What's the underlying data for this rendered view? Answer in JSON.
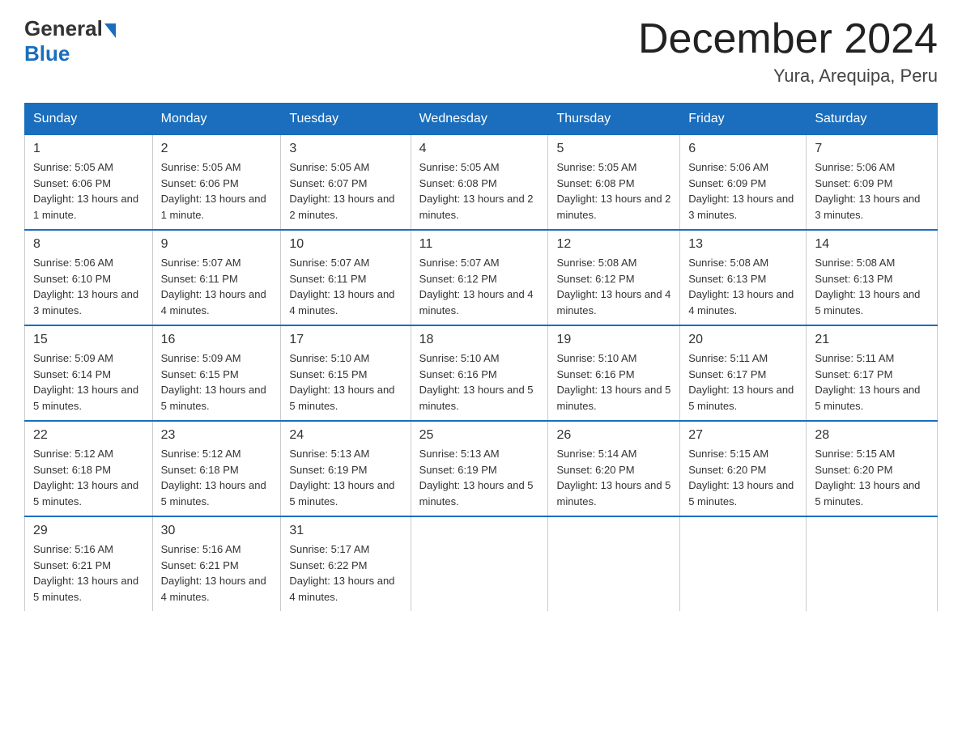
{
  "header": {
    "logo": {
      "general": "General",
      "blue": "Blue"
    },
    "title": "December 2024",
    "location": "Yura, Arequipa, Peru"
  },
  "days_header": [
    "Sunday",
    "Monday",
    "Tuesday",
    "Wednesday",
    "Thursday",
    "Friday",
    "Saturday"
  ],
  "weeks": [
    [
      {
        "day": "1",
        "sunrise": "5:05 AM",
        "sunset": "6:06 PM",
        "daylight": "13 hours and 1 minute."
      },
      {
        "day": "2",
        "sunrise": "5:05 AM",
        "sunset": "6:06 PM",
        "daylight": "13 hours and 1 minute."
      },
      {
        "day": "3",
        "sunrise": "5:05 AM",
        "sunset": "6:07 PM",
        "daylight": "13 hours and 2 minutes."
      },
      {
        "day": "4",
        "sunrise": "5:05 AM",
        "sunset": "6:08 PM",
        "daylight": "13 hours and 2 minutes."
      },
      {
        "day": "5",
        "sunrise": "5:05 AM",
        "sunset": "6:08 PM",
        "daylight": "13 hours and 2 minutes."
      },
      {
        "day": "6",
        "sunrise": "5:06 AM",
        "sunset": "6:09 PM",
        "daylight": "13 hours and 3 minutes."
      },
      {
        "day": "7",
        "sunrise": "5:06 AM",
        "sunset": "6:09 PM",
        "daylight": "13 hours and 3 minutes."
      }
    ],
    [
      {
        "day": "8",
        "sunrise": "5:06 AM",
        "sunset": "6:10 PM",
        "daylight": "13 hours and 3 minutes."
      },
      {
        "day": "9",
        "sunrise": "5:07 AM",
        "sunset": "6:11 PM",
        "daylight": "13 hours and 4 minutes."
      },
      {
        "day": "10",
        "sunrise": "5:07 AM",
        "sunset": "6:11 PM",
        "daylight": "13 hours and 4 minutes."
      },
      {
        "day": "11",
        "sunrise": "5:07 AM",
        "sunset": "6:12 PM",
        "daylight": "13 hours and 4 minutes."
      },
      {
        "day": "12",
        "sunrise": "5:08 AM",
        "sunset": "6:12 PM",
        "daylight": "13 hours and 4 minutes."
      },
      {
        "day": "13",
        "sunrise": "5:08 AM",
        "sunset": "6:13 PM",
        "daylight": "13 hours and 4 minutes."
      },
      {
        "day": "14",
        "sunrise": "5:08 AM",
        "sunset": "6:13 PM",
        "daylight": "13 hours and 5 minutes."
      }
    ],
    [
      {
        "day": "15",
        "sunrise": "5:09 AM",
        "sunset": "6:14 PM",
        "daylight": "13 hours and 5 minutes."
      },
      {
        "day": "16",
        "sunrise": "5:09 AM",
        "sunset": "6:15 PM",
        "daylight": "13 hours and 5 minutes."
      },
      {
        "day": "17",
        "sunrise": "5:10 AM",
        "sunset": "6:15 PM",
        "daylight": "13 hours and 5 minutes."
      },
      {
        "day": "18",
        "sunrise": "5:10 AM",
        "sunset": "6:16 PM",
        "daylight": "13 hours and 5 minutes."
      },
      {
        "day": "19",
        "sunrise": "5:10 AM",
        "sunset": "6:16 PM",
        "daylight": "13 hours and 5 minutes."
      },
      {
        "day": "20",
        "sunrise": "5:11 AM",
        "sunset": "6:17 PM",
        "daylight": "13 hours and 5 minutes."
      },
      {
        "day": "21",
        "sunrise": "5:11 AM",
        "sunset": "6:17 PM",
        "daylight": "13 hours and 5 minutes."
      }
    ],
    [
      {
        "day": "22",
        "sunrise": "5:12 AM",
        "sunset": "6:18 PM",
        "daylight": "13 hours and 5 minutes."
      },
      {
        "day": "23",
        "sunrise": "5:12 AM",
        "sunset": "6:18 PM",
        "daylight": "13 hours and 5 minutes."
      },
      {
        "day": "24",
        "sunrise": "5:13 AM",
        "sunset": "6:19 PM",
        "daylight": "13 hours and 5 minutes."
      },
      {
        "day": "25",
        "sunrise": "5:13 AM",
        "sunset": "6:19 PM",
        "daylight": "13 hours and 5 minutes."
      },
      {
        "day": "26",
        "sunrise": "5:14 AM",
        "sunset": "6:20 PM",
        "daylight": "13 hours and 5 minutes."
      },
      {
        "day": "27",
        "sunrise": "5:15 AM",
        "sunset": "6:20 PM",
        "daylight": "13 hours and 5 minutes."
      },
      {
        "day": "28",
        "sunrise": "5:15 AM",
        "sunset": "6:20 PM",
        "daylight": "13 hours and 5 minutes."
      }
    ],
    [
      {
        "day": "29",
        "sunrise": "5:16 AM",
        "sunset": "6:21 PM",
        "daylight": "13 hours and 5 minutes."
      },
      {
        "day": "30",
        "sunrise": "5:16 AM",
        "sunset": "6:21 PM",
        "daylight": "13 hours and 4 minutes."
      },
      {
        "day": "31",
        "sunrise": "5:17 AM",
        "sunset": "6:22 PM",
        "daylight": "13 hours and 4 minutes."
      },
      null,
      null,
      null,
      null
    ]
  ]
}
